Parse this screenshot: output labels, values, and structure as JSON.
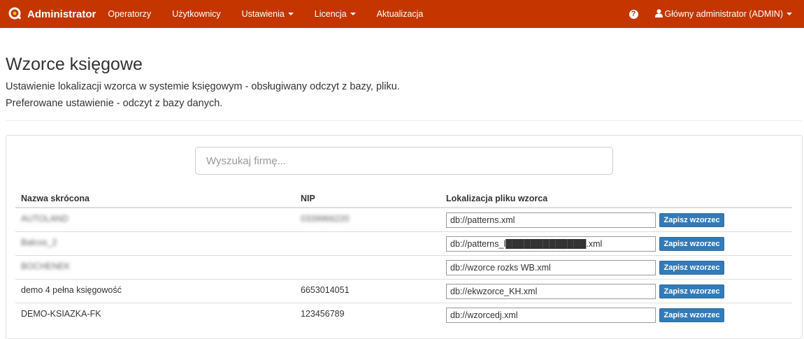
{
  "navbar": {
    "brand": "Administrator",
    "items": [
      {
        "label": "Operatorzy",
        "dropdown": false
      },
      {
        "label": "Użytkownicy",
        "dropdown": false
      },
      {
        "label": "Ustawienia",
        "dropdown": true
      },
      {
        "label": "Licencja",
        "dropdown": true
      },
      {
        "label": "Aktualizacja",
        "dropdown": false
      }
    ],
    "help_glyph": "?",
    "user": "Główny administrator (ADMIN)"
  },
  "page": {
    "title": "Wzorce księgowe",
    "desc1": "Ustawienie lokalizacji wzorca w systemie księgowym - obsługiwany odczyt z bazy, pliku.",
    "desc2": "Preferowane ustawienie - odczyt z bazy danych."
  },
  "search": {
    "placeholder": "Wyszukaj firmę..."
  },
  "table": {
    "headers": [
      "Nazwa skrócona",
      "NIP",
      "Lokalizacja pliku wzorca"
    ],
    "save_label": "Zapisz wzorzec",
    "rows": [
      {
        "name": "AUTOLAND",
        "nip": "0339966220",
        "location": "db://patterns.xml",
        "blurred": true
      },
      {
        "name": "Balcos_2",
        "nip": "",
        "location": "db://patterns_l█████████████.xml",
        "blurred": true
      },
      {
        "name": "BOCHENEK",
        "nip": "",
        "location": "db://wzorce rozks WB.xml",
        "blurred": true
      },
      {
        "name": "demo 4 pełna księgowość",
        "nip": "6653014051",
        "location": "db://ekwzorce_KH.xml",
        "blurred": false
      },
      {
        "name": "DEMO-KSIAZKA-FK",
        "nip": "123456789",
        "location": "db://wzorcedj.xml",
        "blurred": false
      }
    ]
  },
  "colors": {
    "navbar": "#c43500",
    "button": "#337ab7"
  }
}
